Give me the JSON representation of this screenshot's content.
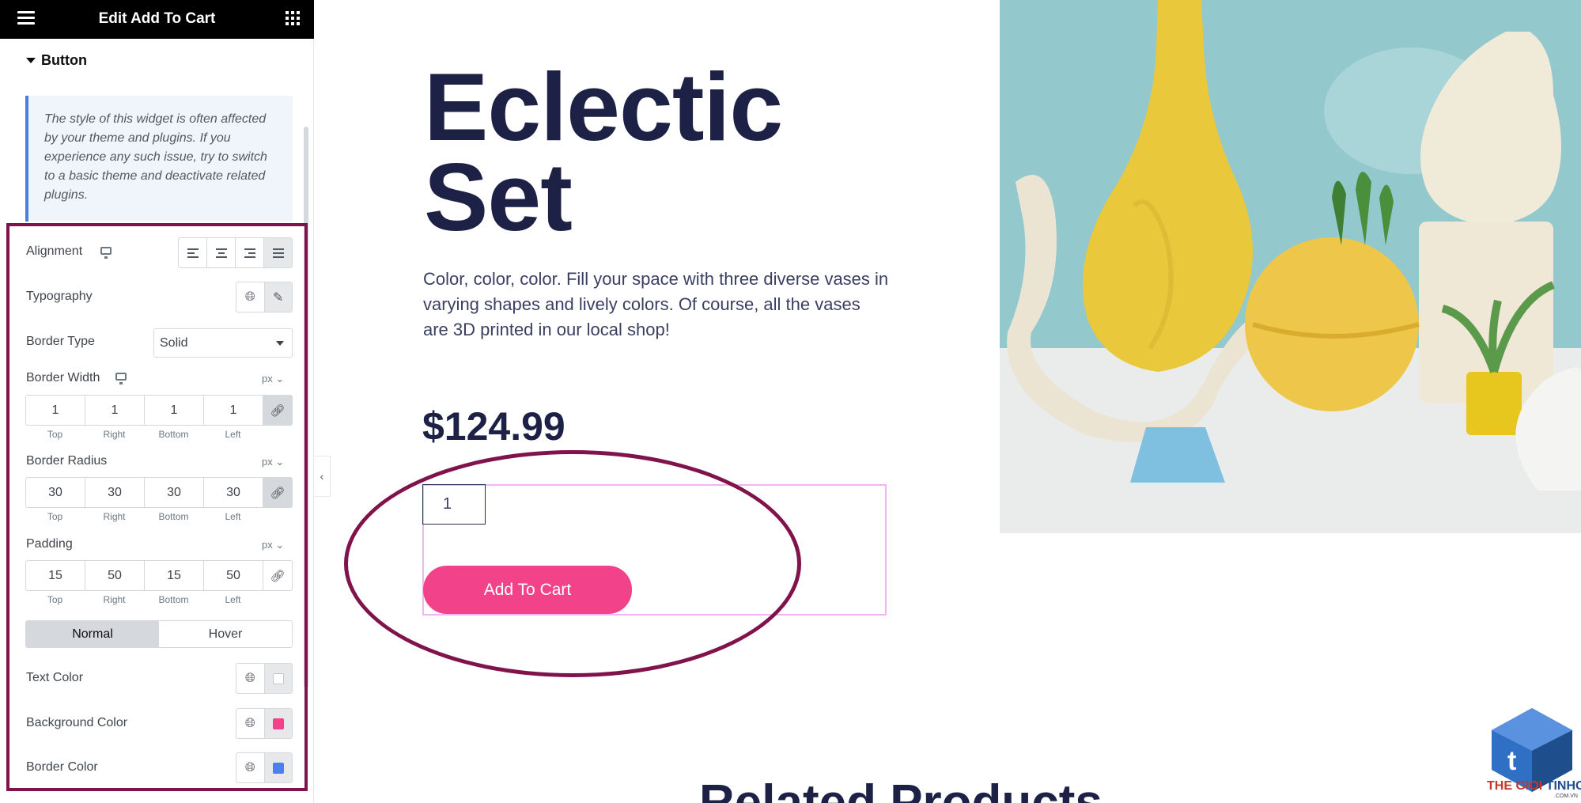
{
  "panel": {
    "header_title": "Edit Add To Cart",
    "section_title": "Button",
    "notice_text": "The style of this widget is often affected by your theme and plugins. If you experience any such issue, try to switch to a basic theme and deactivate related plugins.",
    "alignment_label": "Alignment",
    "typography_label": "Typography",
    "border_type_label": "Border Type",
    "border_type_value": "Solid",
    "border_width_label": "Border Width",
    "border_width_unit": "px",
    "border_width_values": [
      "1",
      "1",
      "1",
      "1"
    ],
    "border_radius_label": "Border Radius",
    "border_radius_unit": "px",
    "border_radius_values": [
      "30",
      "30",
      "30",
      "30"
    ],
    "padding_label": "Padding",
    "padding_unit": "px",
    "padding_values": [
      "15",
      "50",
      "15",
      "50"
    ],
    "dim_labels": [
      "Top",
      "Right",
      "Bottom",
      "Left"
    ],
    "tabs": [
      "Normal",
      "Hover"
    ],
    "active_tab": "Normal",
    "text_color_label": "Text Color",
    "text_color": "#ffffff",
    "background_color_label": "Background Color",
    "background_color": "#f2438a",
    "border_color_label": "Border Color",
    "border_color": "#4a7ff0",
    "icons": [
      "hamburger-icon",
      "apps-grid-icon",
      "desktop-icon",
      "globe-icon",
      "pencil-icon",
      "link-icon",
      "chevron-left-icon"
    ]
  },
  "product": {
    "title_line1": "Eclectic",
    "title_line2": "Set",
    "description": "Color, color, color. Fill your space with three diverse vases in varying shapes and lively colors. Of course, all the vases are 3D printed in our local shop!",
    "price": "$124.99",
    "quantity": "1",
    "button_label": "Add To Cart",
    "related_heading": "Related Products"
  },
  "branding": {
    "line1": "THE GIOI",
    "line2": "TINHOC",
    "sub": ".COM.VN"
  },
  "colors": {
    "accent_pink": "#f2438a",
    "heading_navy": "#1d2146",
    "highlight_maroon": "#80134b"
  }
}
